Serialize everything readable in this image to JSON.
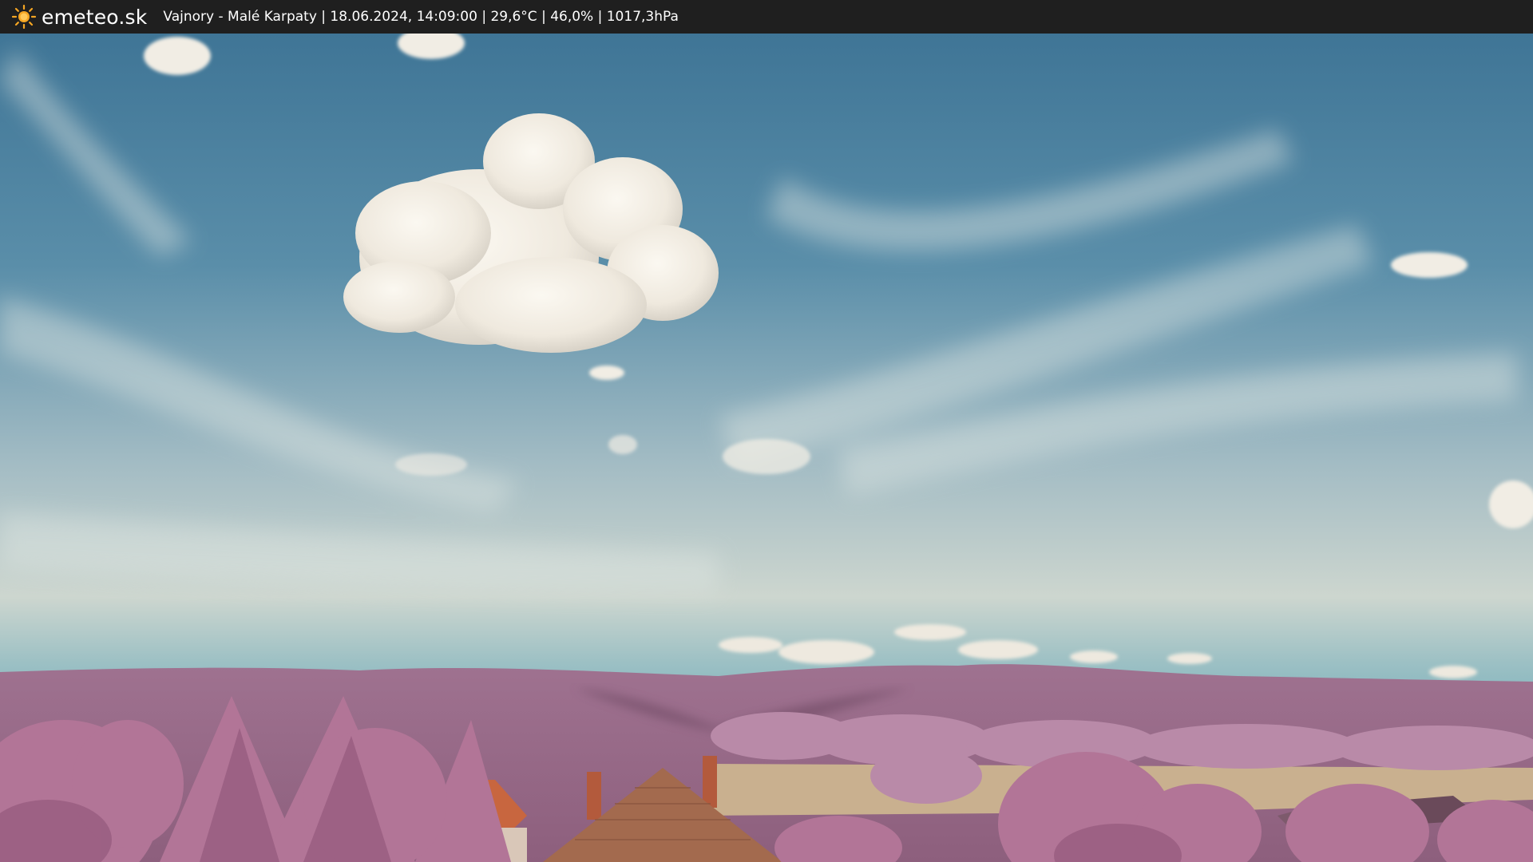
{
  "header": {
    "site_name": "emeteo.sk",
    "info_line": "Vajnory - Malé Karpaty | 18.06.2024, 14:09:00 | 29,6°C | 46,0% | 1017,3hPa",
    "logo_icon": "sun-icon",
    "colors": {
      "bar": "#1f1f1f",
      "sun": "#f5a623",
      "text": "#ffffff"
    }
  },
  "image": {
    "subject": "infrared webcam landscape",
    "colors": {
      "sky_top": "#4b7f9f",
      "sky_horizon": "#c7d3cd",
      "hills": "#9a6a88",
      "trees": "#b67a9c",
      "roof": "#c8663f"
    }
  }
}
